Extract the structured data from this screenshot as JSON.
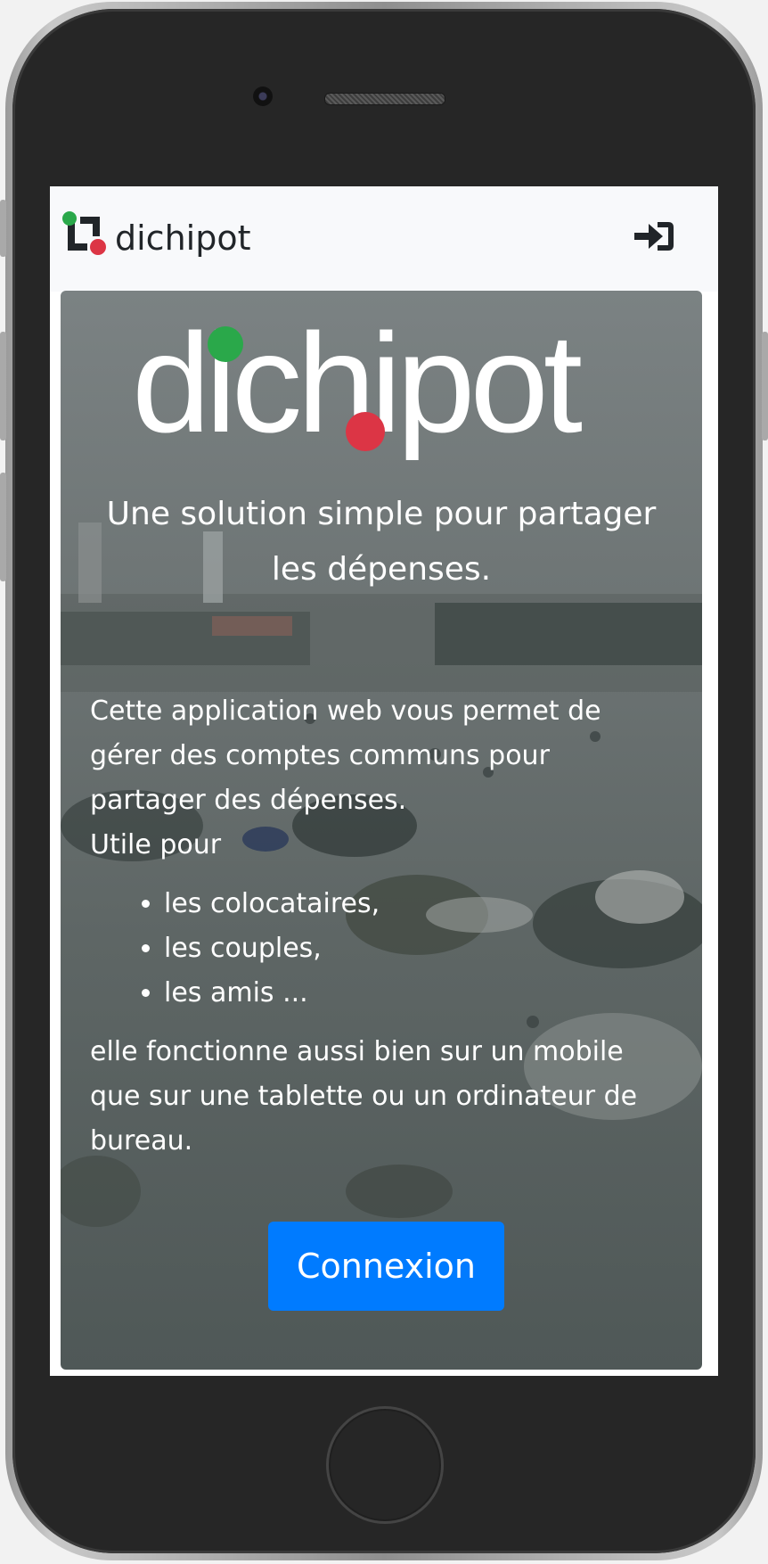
{
  "navbar": {
    "brand": "dichipot",
    "login_icon": "sign-in-icon"
  },
  "hero": {
    "logo_text": "dichipot",
    "tagline": "Une solution simple pour partager les dépenses.",
    "intro": [
      "Cette application web vous permet de gérer des comptes communs pour partager des dépenses.",
      "Utile pour"
    ],
    "list": [
      "les colocataires,",
      "les couples,",
      "les amis ..."
    ],
    "closing": "elle fonctionne aussi bien sur un mobile que sur une tablette ou un ordinateur de bureau.",
    "button_label": "Connexion"
  },
  "colors": {
    "accent": "#007bff",
    "logo_green": "#2aa84a",
    "logo_red": "#dc3545"
  }
}
